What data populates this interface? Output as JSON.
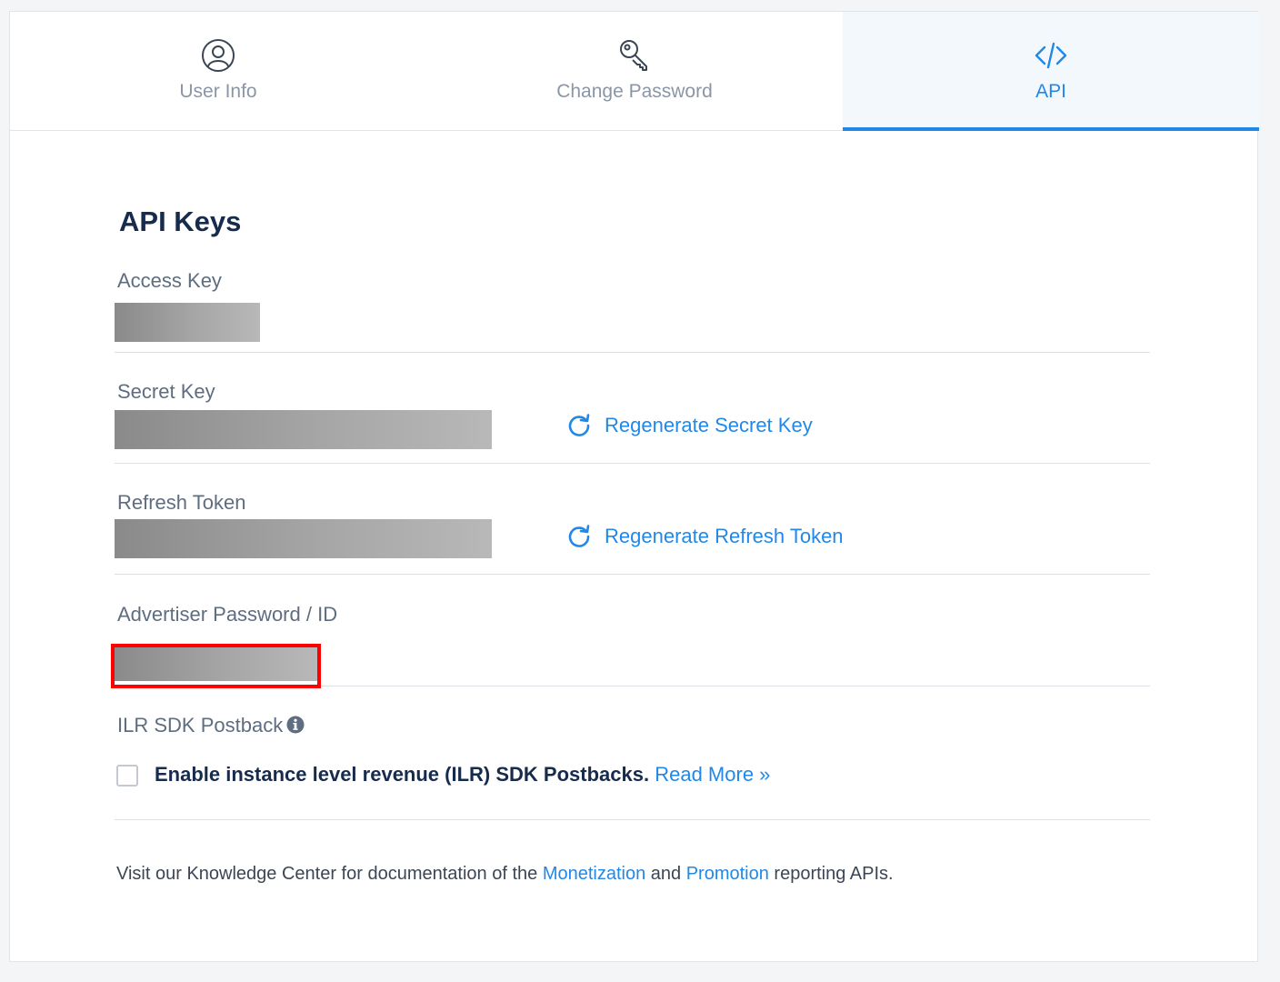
{
  "tabs": [
    {
      "label": "User Info",
      "icon": "user-circle-icon",
      "active": false
    },
    {
      "label": "Change Password",
      "icon": "key-icon",
      "active": false
    },
    {
      "label": "API",
      "icon": "code-icon",
      "active": true
    }
  ],
  "api_keys": {
    "title": "API Keys",
    "access_key": {
      "label": "Access Key"
    },
    "secret_key": {
      "label": "Secret Key",
      "action": "Regenerate Secret Key"
    },
    "refresh_token": {
      "label": "Refresh Token",
      "action": "Regenerate Refresh Token"
    },
    "advertiser": {
      "label": "Advertiser Password / ID"
    },
    "ilr": {
      "label": "ILR SDK Postback",
      "checkbox_text": "Enable instance level revenue (ILR) SDK Postbacks.",
      "read_more": "Read More »",
      "checked": false
    }
  },
  "footer": {
    "prefix": "Visit our Knowledge Center for documentation of the ",
    "monetization": "Monetization",
    "and": " and ",
    "promotion": "Promotion",
    "suffix": " reporting APIs."
  },
  "colors": {
    "accent": "#2188e8",
    "heading": "#172b4d",
    "label": "#5f6d80",
    "highlight": "#ff0000"
  }
}
